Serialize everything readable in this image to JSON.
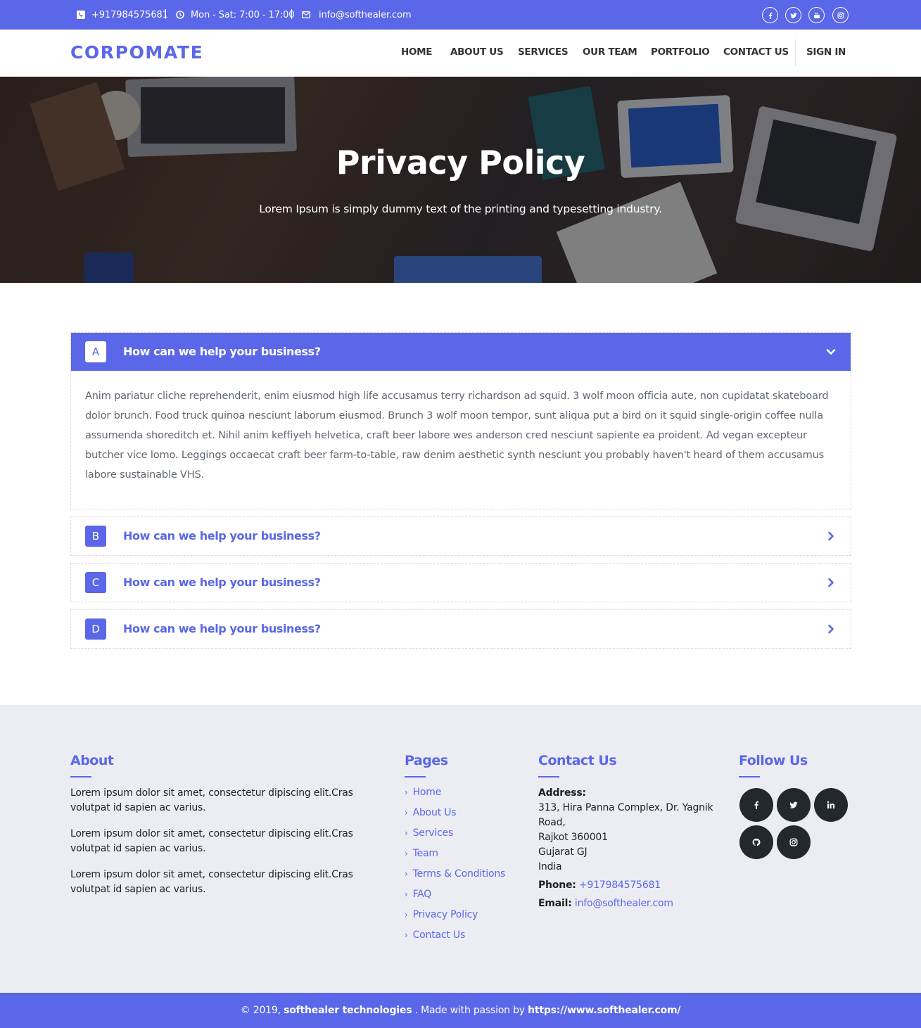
{
  "topbar": {
    "phone": "+917984575681",
    "hours": "Mon - Sat: 7:00 - 17:00",
    "email": "info@softhealer.com",
    "icons": [
      "phone-icon",
      "clock-icon",
      "envelope-icon"
    ],
    "social": [
      "facebook-icon",
      "twitter-icon",
      "youtube-icon",
      "instagram-icon"
    ]
  },
  "nav": {
    "logo": "CORPOMATE",
    "links": [
      "HOME",
      "ABOUT US",
      "SERVICES",
      "OUR TEAM",
      "PORTFOLIO",
      "CONTACT US"
    ],
    "signin": "SIGN IN"
  },
  "hero": {
    "title": "Privacy Policy",
    "subtitle": "Lorem Ipsum is simply dummy text of the printing and typesetting industry."
  },
  "accordion": [
    {
      "letter": "A",
      "title": "How can we help your business?",
      "expanded": true,
      "body": "Anim pariatur cliche reprehenderit, enim eiusmod high life accusamus terry richardson ad squid. 3 wolf moon officia aute, non cupidatat skateboard dolor brunch. Food truck quinoa nesciunt laborum eiusmod. Brunch 3 wolf moon tempor, sunt aliqua put a bird on it squid single-origin coffee nulla assumenda shoreditch et. Nihil anim keffiyeh helvetica, craft beer labore wes anderson cred nesciunt sapiente ea proident. Ad vegan excepteur butcher vice lomo. Leggings occaecat craft beer farm-to-table, raw denim aesthetic synth nesciunt you probably haven't heard of them accusamus labore sustainable VHS."
    },
    {
      "letter": "B",
      "title": "How can we help your business?",
      "expanded": false
    },
    {
      "letter": "C",
      "title": "How can we help your business?",
      "expanded": false
    },
    {
      "letter": "D",
      "title": "How can we help your business?",
      "expanded": false
    }
  ],
  "footer": {
    "about": {
      "heading": "About",
      "paragraphs": [
        "Lorem ipsum dolor sit amet, consectetur dipiscing elit.Cras volutpat id sapien ac varius.",
        "Lorem ipsum dolor sit amet, consectetur dipiscing elit.Cras volutpat id sapien ac varius.",
        "Lorem ipsum dolor sit amet, consectetur dipiscing elit.Cras volutpat id sapien ac varius."
      ]
    },
    "pages": {
      "heading": "Pages",
      "links": [
        "Home",
        "About Us",
        "Services",
        "Team",
        "Terms & Conditions",
        "FAQ",
        "Privacy Policy",
        "Contact Us"
      ]
    },
    "contact": {
      "heading": "Contact Us",
      "address_label": "Address:",
      "address_lines": [
        "313, Hira Panna Complex, Dr. Yagnik",
        "Road,",
        "Rajkot 360001",
        "Gujarat GJ",
        "India"
      ],
      "phone_label": "Phone:",
      "phone": "+917984575681",
      "email_label": "Email:",
      "email": "info@softhealer.com"
    },
    "follow": {
      "heading": "Follow Us",
      "icons": [
        "facebook-icon",
        "twitter-icon",
        "linkedin-icon",
        "github-icon",
        "instagram-icon"
      ]
    }
  },
  "copyright": {
    "prefix": "© 2019,",
    "company": "softhealer technologies",
    "middle": ". Made with passion by",
    "url": "https://www.softhealer.com/"
  },
  "colors": {
    "accent": "#5a67e8",
    "footer_bg": "#ecedf3",
    "social_bg": "#23272e"
  }
}
